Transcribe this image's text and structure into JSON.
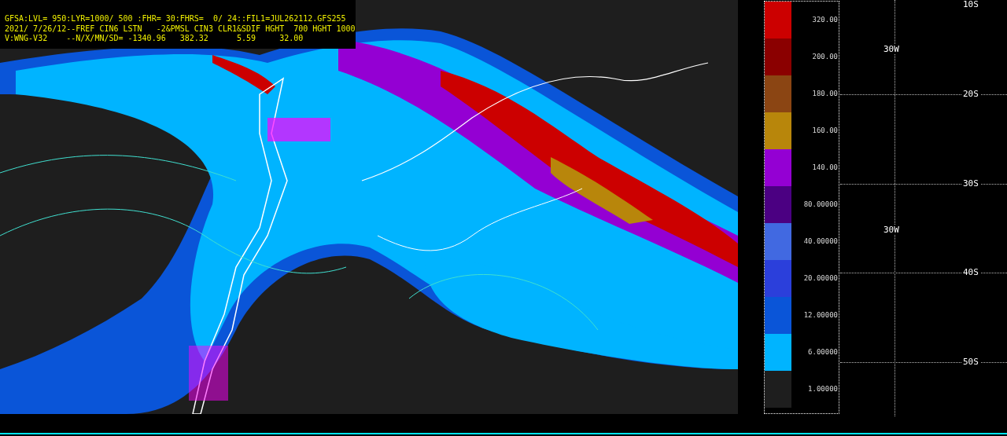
{
  "header": {
    "lines": [
      "GFSA:LVL= 950:LYR=1000/ 500 :FHR= 30:FHRS=  0/ 24::FIL1=JUL262112.GFS255",
      "2021/ 7/26/12--FREF CIN6 LSTN   -2&PMSL CIN3 CLR1&SDIF HGHT  700 HGHT 1000",
      "V:WNG-V32    --N/X/MN/SD= -1340.96   382.32      5.59     32.00"
    ]
  },
  "legend": {
    "bins": [
      {
        "color": "#cc0000",
        "label": "320.00"
      },
      {
        "color": "#8b0000",
        "label": "200.00"
      },
      {
        "color": "#8b4513",
        "label": "180.00"
      },
      {
        "color": "#b8860b",
        "label": "160.00"
      },
      {
        "color": "#9400d3",
        "label": "140.00"
      },
      {
        "color": "#4b0082",
        "label": "80.00000"
      },
      {
        "color": "#4169e1",
        "label": "40.00000"
      },
      {
        "color": "#2b3fdb",
        "label": "20.00000"
      },
      {
        "color": "#0a55d8",
        "label": "12.00000"
      },
      {
        "color": "#00b4ff",
        "label": "6.00000"
      },
      {
        "color": "#1e1e1e",
        "label": "1.00000"
      }
    ]
  },
  "grid_labels": {
    "latitudes": [
      "10S",
      "20S",
      "30S",
      "40S",
      "50S"
    ],
    "longitudes": [
      "30W",
      "30W"
    ]
  }
}
